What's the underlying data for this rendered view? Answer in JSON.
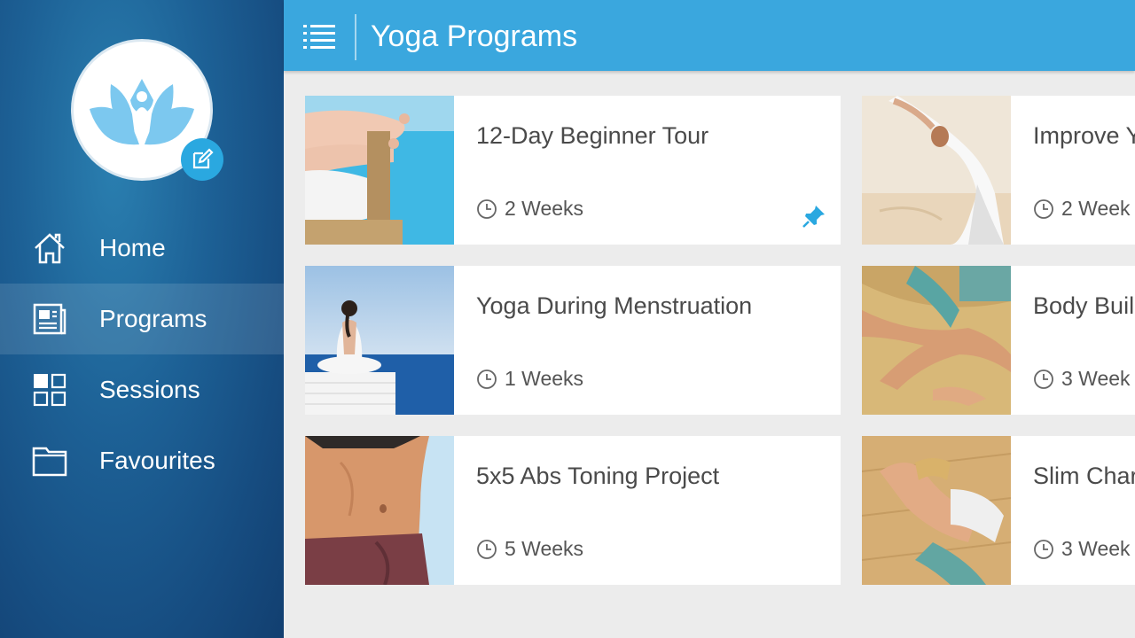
{
  "header": {
    "title": "Yoga Programs",
    "menu_icon": "menu-icon"
  },
  "sidebar": {
    "avatar_icon": "lotus-icon",
    "edit_icon": "edit-icon",
    "items": [
      {
        "label": "Home",
        "icon": "home-icon",
        "active": false
      },
      {
        "label": "Programs",
        "icon": "programs-icon",
        "active": true
      },
      {
        "label": "Sessions",
        "icon": "sessions-icon",
        "active": false
      },
      {
        "label": "Favourites",
        "icon": "folder-icon",
        "active": false
      }
    ]
  },
  "programs": [
    {
      "title": "12-Day Beginner Tour",
      "duration": "2 Weeks",
      "pinned": true
    },
    {
      "title": "Improve Y",
      "duration": "2 Week",
      "pinned": false
    },
    {
      "title": "Yoga During Menstruation",
      "duration": "1 Weeks",
      "pinned": false
    },
    {
      "title": "Body Buil",
      "duration": "3 Week",
      "pinned": false
    },
    {
      "title": "5x5 Abs Toning Project",
      "duration": "5 Weeks",
      "pinned": false
    },
    {
      "title": "Slim Char",
      "duration": "3 Week",
      "pinned": false
    }
  ],
  "colors": {
    "accent": "#3aa7de",
    "sidebar": "#164c80",
    "pin": "#2aa8e0"
  }
}
